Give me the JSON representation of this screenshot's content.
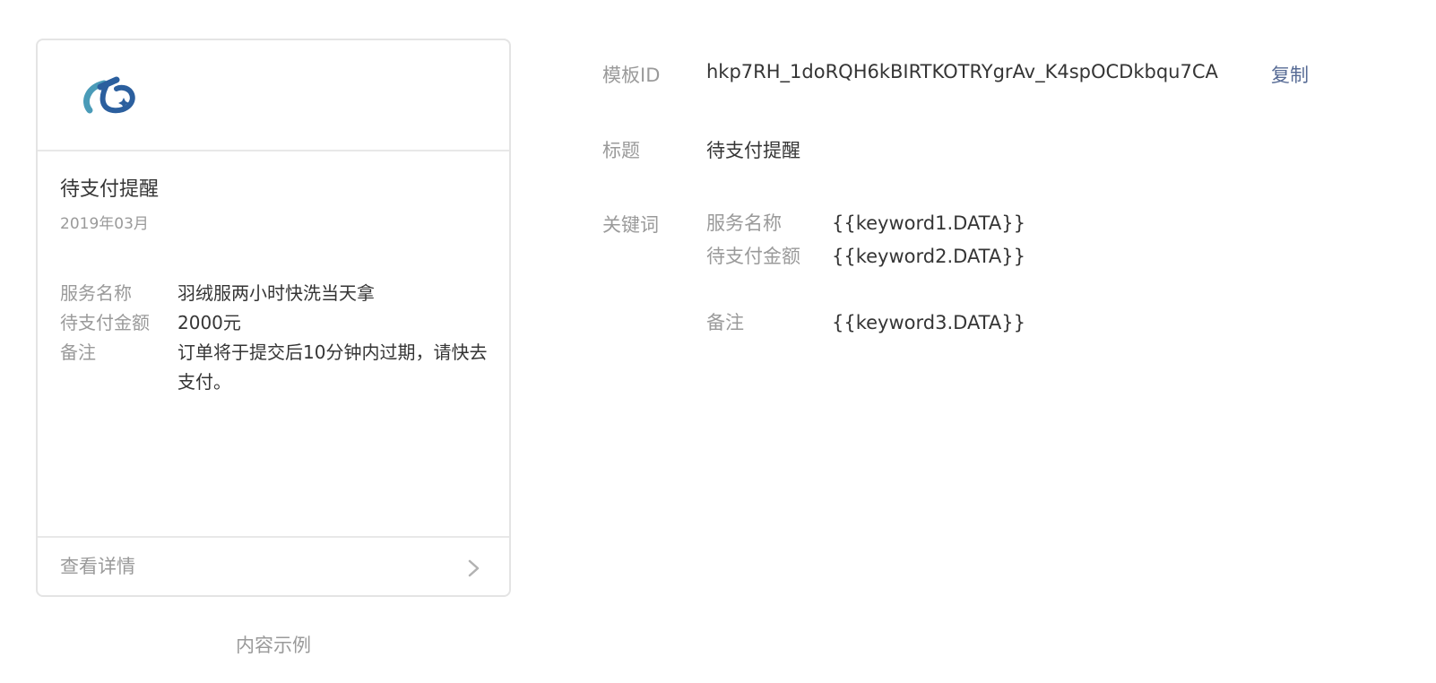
{
  "preview": {
    "title": "待支付提醒",
    "date": "2019年03月",
    "fields": [
      {
        "label": "服务名称",
        "value": "羽绒服两小时快洗当天拿"
      },
      {
        "label": "待支付金额",
        "value": "2000元"
      },
      {
        "label": "备注",
        "value": "订单将于提交后10分钟内过期，请快去支付。"
      }
    ],
    "footer_label": "查看详情",
    "logo_icon": "brand-logo",
    "chevron_icon": "chevron-right-icon"
  },
  "caption": "内容示例",
  "details": {
    "template_id_label": "模板ID",
    "template_id_value": "hkp7RH_1doRQH6kBIRTKOTRYgrAv_K4spOCDkbqu7CA",
    "copy_label": "复制",
    "title_label": "标题",
    "title_value": "待支付提醒",
    "keywords_label": "关键词",
    "keywords": [
      {
        "name": "服务名称",
        "value": "{{keyword1.DATA}}"
      },
      {
        "name": "待支付金额",
        "value": "{{keyword2.DATA}}"
      },
      {
        "name": "备注",
        "value": "{{keyword3.DATA}}"
      }
    ]
  },
  "colors": {
    "link": "#576b95",
    "muted_text": "#9a9a9a",
    "main_text": "#353535",
    "border": "#e4e4e4",
    "logo_blue": "#2b5f9e",
    "logo_teal": "#4a9bb8"
  }
}
